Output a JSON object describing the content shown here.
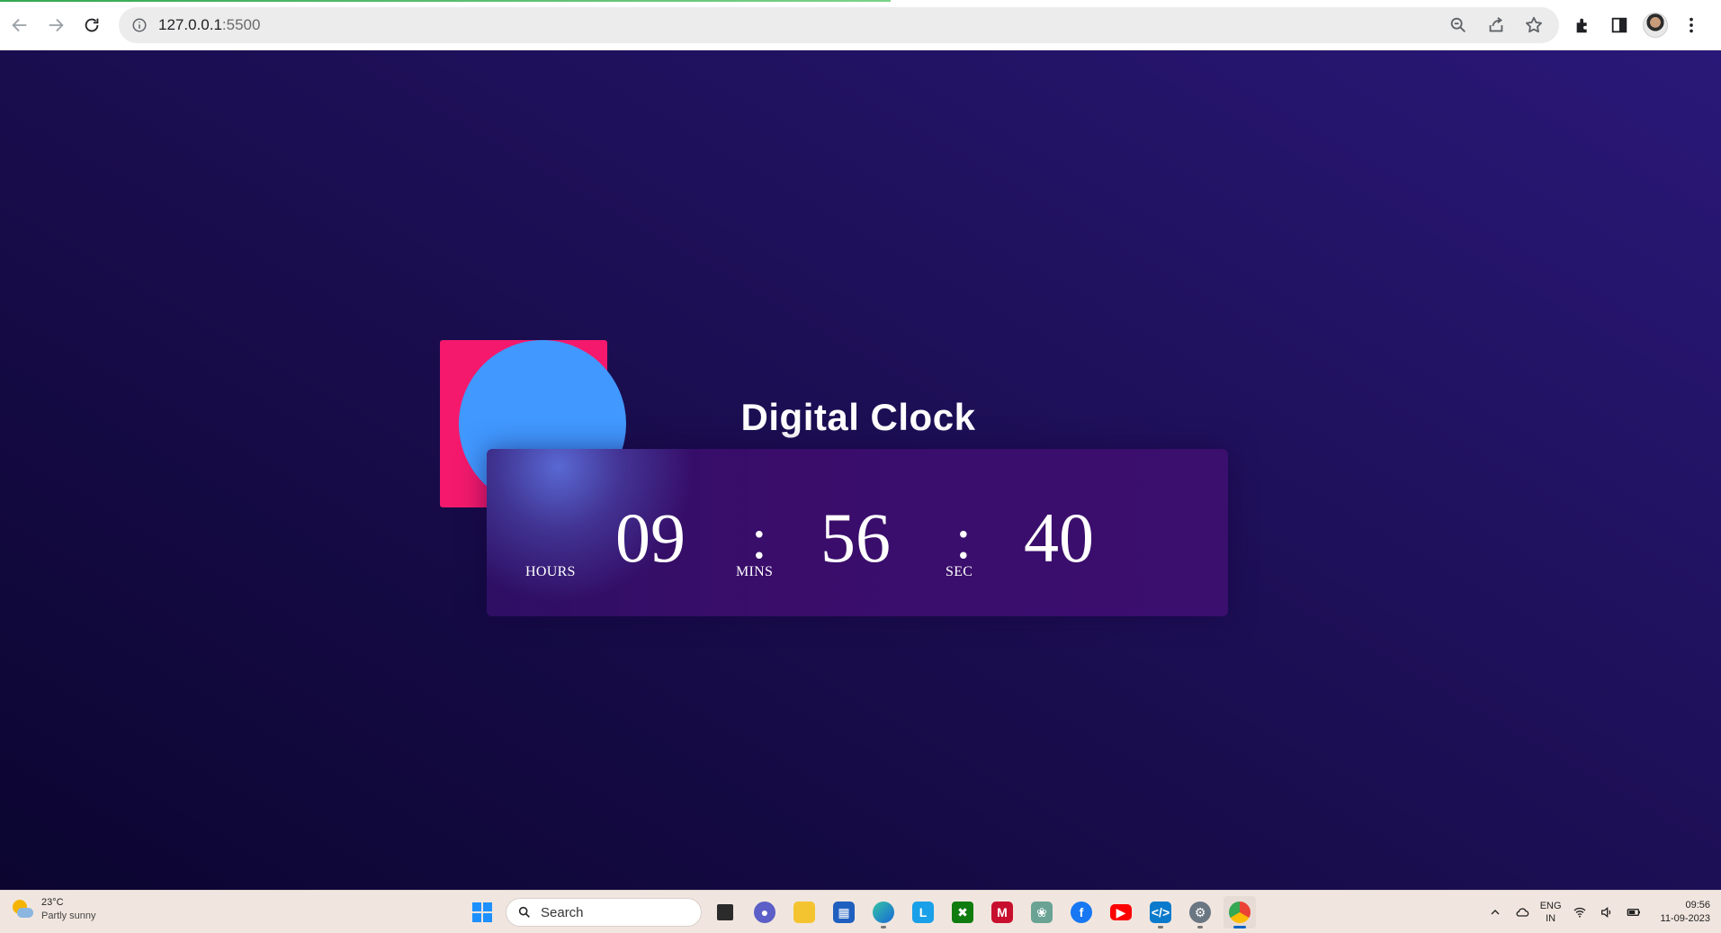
{
  "browser": {
    "url_host": "127.0.0.1",
    "url_port": ":5500"
  },
  "page": {
    "title": "Digital Clock",
    "hours": "09",
    "minutes": "56",
    "seconds": "40",
    "hours_label": "HOURS",
    "minutes_label": "MINS",
    "seconds_label": "SEC",
    "separator": ":",
    "colors": {
      "square": "#f4196c",
      "circle": "#4198ff",
      "panel": "#3a0d6b"
    }
  },
  "taskbar": {
    "weather_temp": "23°C",
    "weather_condition": "Partly sunny",
    "search_label": "Search",
    "apps": [
      "file-explorer",
      "teams",
      "folder",
      "store",
      "edge",
      "app-l",
      "xbox",
      "mcafee",
      "chatgpt",
      "facebook",
      "youtube",
      "vscode",
      "settings",
      "chrome"
    ],
    "lang_top": "ENG",
    "lang_bottom": "IN",
    "time": "09:56",
    "date": "11-09-2023"
  }
}
